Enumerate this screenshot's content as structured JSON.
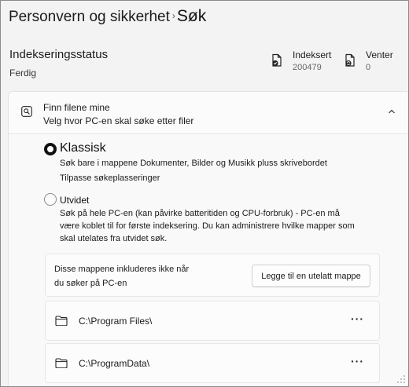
{
  "header": {
    "breadcrumb_parent": "Personvern og sikkerhet",
    "breadcrumb_separator": "›",
    "breadcrumb_current": "Søk"
  },
  "indexing": {
    "title": "Indekseringsstatus",
    "status": "Ferdig",
    "indexed_label": "Indeksert",
    "indexed_count": "200479",
    "pending_label": "Venter",
    "pending_count": "0"
  },
  "find_files": {
    "title": "Finn filene mine",
    "subtitle": "Velg hvor PC-en skal søke etter filer",
    "classic": {
      "title": "Klassisk",
      "selected": true,
      "description": "Søk bare i mappene Dokumenter, Bilder og Musikk pluss skrivebordet",
      "link": "Tilpasse søkeplasseringer"
    },
    "enhanced": {
      "title": "Utvidet",
      "selected": false,
      "description_lines": [
        "Søk på hele PC-en (kan påvirke batteritiden og CPU-forbruk) - PC-en må",
        "være koblet til for første indeksering. Du kan administrere hvilke mapper som",
        "skal utelates fra utvidet søk."
      ]
    }
  },
  "excluded": {
    "text_lines": [
      "Disse mappene inkluderes ikke når",
      "du søker på PC-en"
    ],
    "add_button": "Legge til en utelatt mappe",
    "folders": [
      {
        "path": "C:\\Program Files\\",
        "more": "···"
      },
      {
        "path": "C:\\ProgramData\\",
        "more": "···"
      }
    ]
  },
  "icons": {
    "search": "search-icon",
    "indexed": "document-check-icon",
    "pending": "document-sync-icon",
    "collapse": "chevron-up-icon",
    "folder": "folder-icon"
  }
}
